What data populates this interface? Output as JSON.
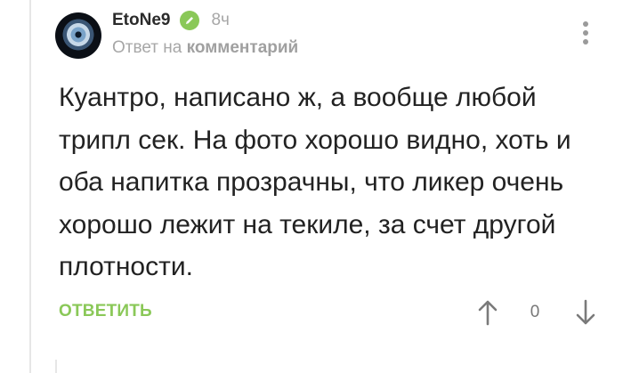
{
  "comment": {
    "author": "EtoNe9",
    "time": "8ч",
    "reply_prefix": "Ответ на",
    "reply_target": "комментарий",
    "body_lines": [
      "Куантро, написано ж, а вообще любой",
      "трипл сек. На фото хорошо видно, хоть и",
      "оба напитка прозрачны, что ликер очень",
      "хорошо лежит на текиле, за счет другой",
      "плотности."
    ]
  },
  "actions": {
    "reply_label": "ОТВЕТИТЬ",
    "vote_count": "0"
  },
  "icons": {
    "badge": "pencil-icon",
    "more": "more-vertical-icon",
    "upvote": "arrow-up-icon",
    "downvote": "arrow-down-icon"
  },
  "colors": {
    "accent": "#8ac858",
    "muted_text": "#a7a7a7",
    "body_text": "#222222"
  }
}
